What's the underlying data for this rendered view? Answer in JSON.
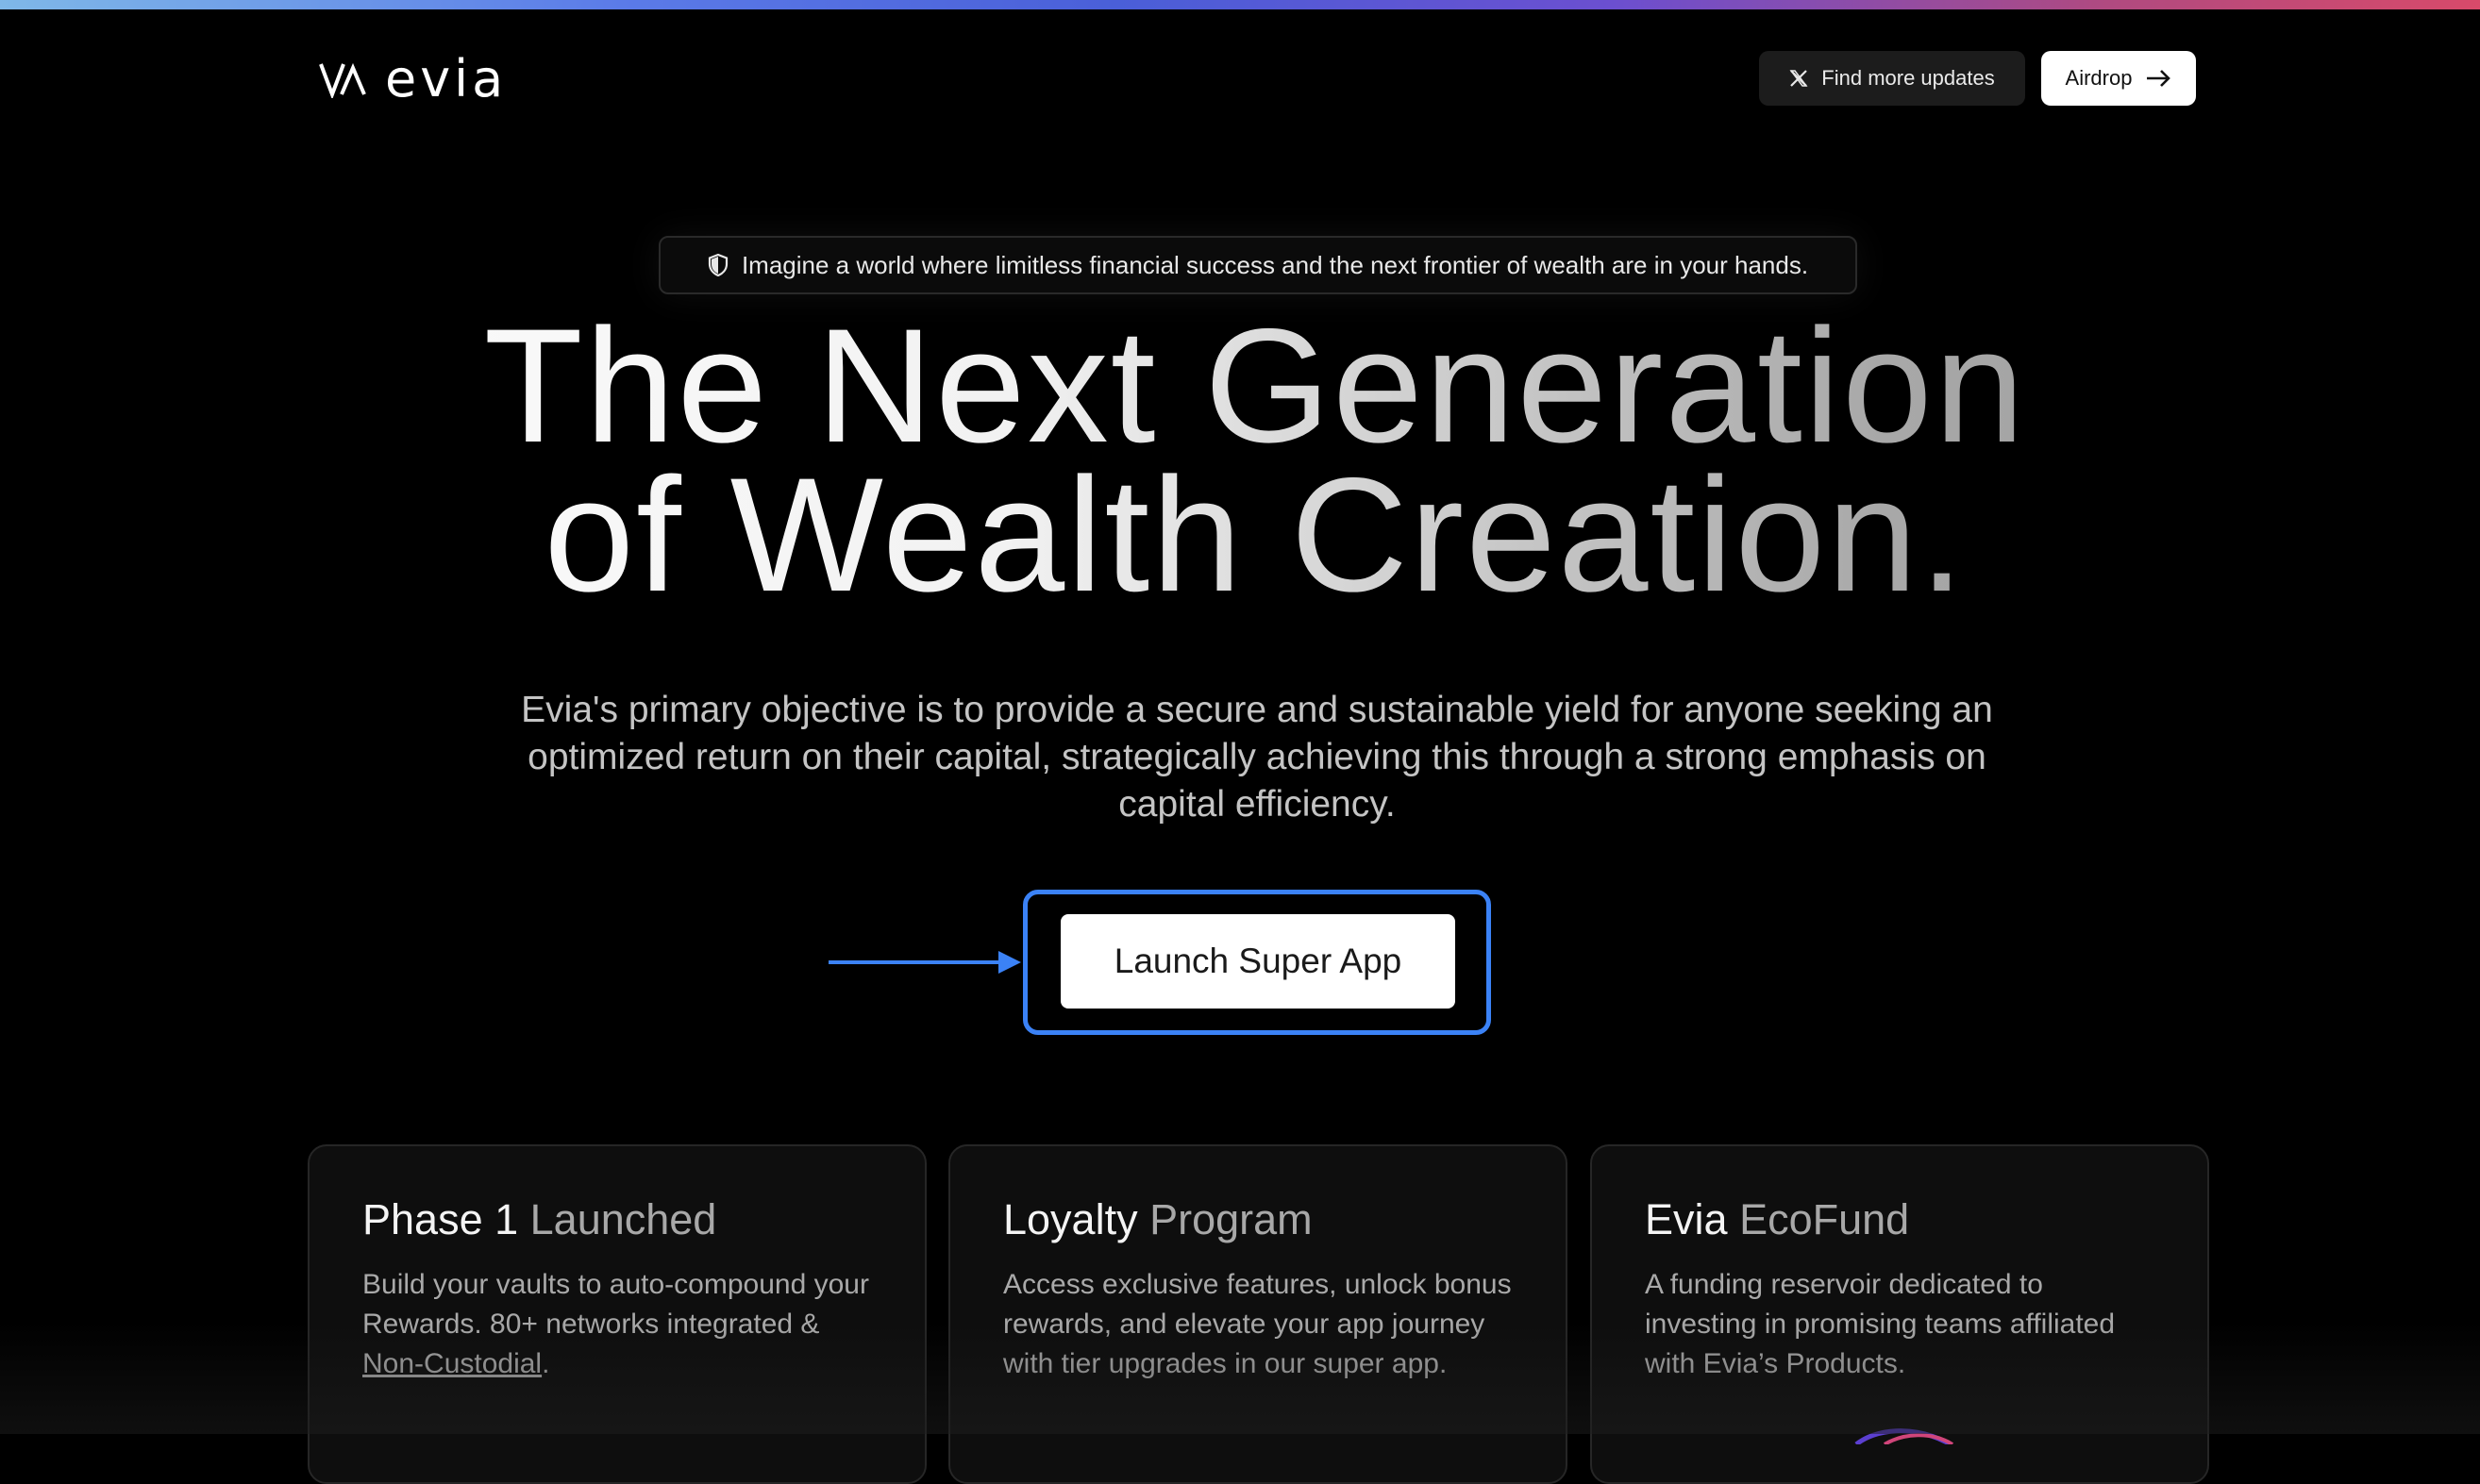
{
  "brand": {
    "name": "evia"
  },
  "header": {
    "updates_label": "Find more updates",
    "airdrop_label": "Airdrop"
  },
  "announcement": {
    "text": "Imagine a world where limitless financial success and the next frontier of wealth are in your hands."
  },
  "hero": {
    "title_line1": "The Next Generation",
    "title_line2": "of Wealth Creation.",
    "description": "Evia's primary objective is to provide a secure and sustainable yield for anyone seeking an optimized return on their capital, strategically achieving this through a strong emphasis on capital efficiency.",
    "cta_label": "Launch Super App"
  },
  "cards": [
    {
      "title_main": "Phase 1",
      "title_muted": "Launched",
      "body_text": "Build your vaults to auto-compound your Rewards. 80+ networks integrated & ",
      "body_link": "Non-Custodial",
      "body_end": "."
    },
    {
      "title_main": "Loyalty",
      "title_muted": "Program",
      "body_text": "Access exclusive features, unlock bonus rewards, and elevate your app journey with tier upgrades in our super app."
    },
    {
      "title_main": "Evia",
      "title_muted": "EcoFund",
      "body_text": "A funding reservoir dedicated to investing in promising teams affiliated with Evia’s Products."
    }
  ],
  "icons": {
    "logo": "evia-logo-mark",
    "updates": "x-logo-icon",
    "airdrop": "arrow-right-icon",
    "announcement": "shield-icon",
    "cta_pointer": "arrow-pointer-icon"
  },
  "colors": {
    "background": "#000000",
    "accent_blue": "#3b82f6",
    "card_bg": "#0e0e0e"
  }
}
